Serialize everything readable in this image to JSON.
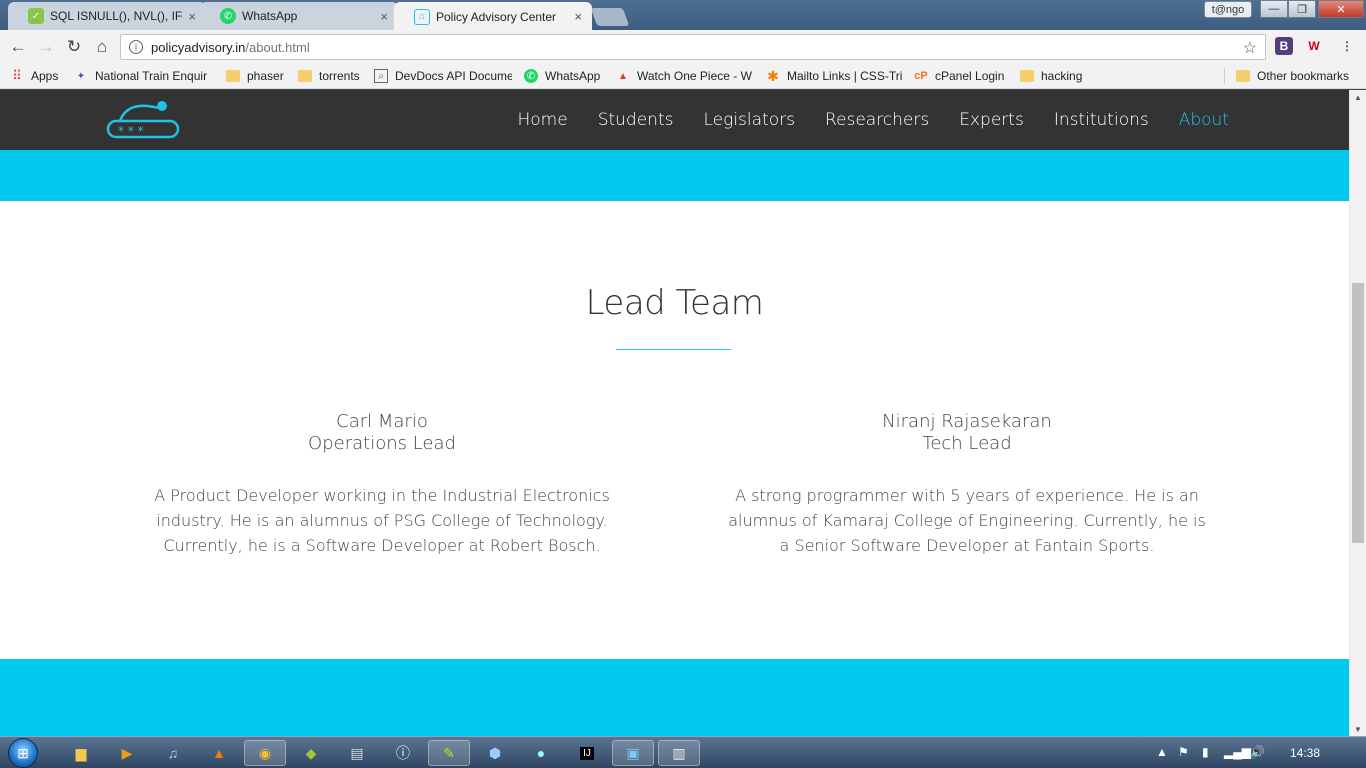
{
  "browser": {
    "tabs": [
      {
        "title": "SQL ISNULL(), NVL(), IFNU",
        "close": "×"
      },
      {
        "title": "WhatsApp",
        "close": "×"
      },
      {
        "title": "Policy Advisory Center",
        "close": "×"
      }
    ],
    "profile_label": "t@ngo",
    "url_host": "policyadvisory.in",
    "url_path": "/about.html",
    "bookmarks": [
      "Apps",
      "National Train Enquir",
      "phaser",
      "torrents",
      "DevDocs API Docume",
      "WhatsApp",
      "Watch One Piece - W",
      "Mailto Links | CSS-Tri",
      "cPanel Login",
      "hacking",
      "Other bookmarks"
    ]
  },
  "site": {
    "nav": [
      "Home",
      "Students",
      "Legislators",
      "Researchers",
      "Experts",
      "Institutions",
      "About"
    ],
    "active_nav": "About",
    "accent_color": "#00c8ee",
    "section_title": "Lead Team",
    "members": [
      {
        "name": "Carl Mario",
        "role": "Operations Lead",
        "bio": "A Product Developer working in the Industrial Electronics industry. He is an alumnus of PSG College of Technology. Currently, he is a Software Developer at Robert Bosch."
      },
      {
        "name": "Niranj Rajasekaran",
        "role": "Tech Lead",
        "bio": "A strong programmer with 5 years of experience. He is an alumnus of Kamaraj College of Engineering. Currently, he is a Senior Software Developer at Fantain Sports."
      }
    ]
  },
  "taskbar": {
    "clock": "14:38"
  }
}
